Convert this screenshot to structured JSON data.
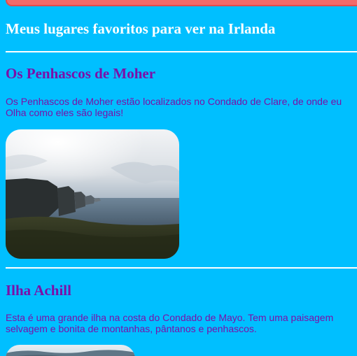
{
  "page": {
    "title": "Meus lugares favoritos para ver na Irlanda"
  },
  "sections": [
    {
      "heading": "Os Penhascos de Moher",
      "line1": "Os Penhascos de Moher estão localizados no Condado de Clare, de onde eu",
      "line2": "Olha como eles são legais!",
      "image": "cliffs-photo"
    },
    {
      "heading": "Ilha Achill",
      "line1": "Esta é uma grande ilha na costa do Condado de Mayo. Tem uma paisagem",
      "line2": "selvagem e bonita de montanhas, pântanos e penhascos.",
      "image": "island-photo"
    }
  ],
  "colors": {
    "background": "#00BFFF",
    "heading": "#FFFFFF",
    "section_text": "#7B10A8",
    "banner": "#F26A6A"
  }
}
